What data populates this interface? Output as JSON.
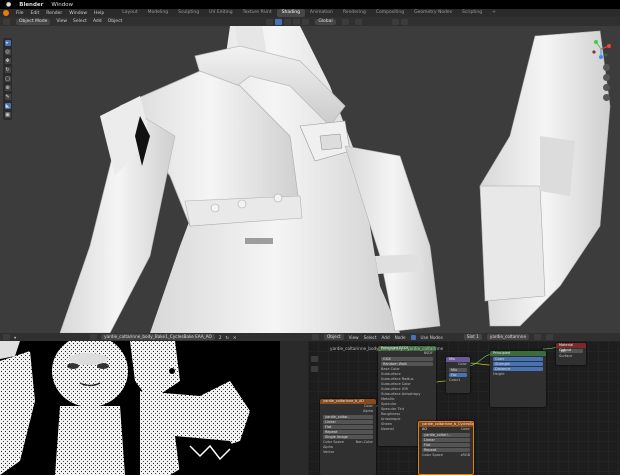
{
  "os_bar": {
    "app": "Blender",
    "menu": "Window"
  },
  "menu": {
    "items": [
      "File",
      "Edit",
      "Render",
      "Window",
      "Help"
    ]
  },
  "workspaces": {
    "tabs": [
      "Layout",
      "Modeling",
      "Sculpting",
      "UV Editing",
      "Texture Paint",
      "Shading",
      "Animation",
      "Rendering",
      "Compositing",
      "Geometry Nodes",
      "Scripting"
    ],
    "active": "Shading",
    "add": "+"
  },
  "viewport_header": {
    "mode": "Object Mode",
    "menus": [
      "View",
      "Select",
      "Add",
      "Object"
    ],
    "orientation": "Global"
  },
  "toolbar": {
    "tools": [
      "select",
      "cursor",
      "move",
      "rotate",
      "scale",
      "transform",
      "annotate",
      "measure",
      "add-cube"
    ]
  },
  "image_editor": {
    "image_name": "yardie_coltarinne_body_Bake1_CyclesBake EAA_AO",
    "datablock_buttons": [
      "2",
      "↻",
      "✕"
    ]
  },
  "node_editor": {
    "object_mode": "Object",
    "menus": [
      "View",
      "Select",
      "Add",
      "Node"
    ],
    "use_nodes_label": "Use Nodes",
    "slot": "Slot 1",
    "material": "yardie_coltarinne",
    "breadcrumb": "yardie_coltarinne_body_temporary   ›   yardie_coltarinne"
  },
  "nodes": {
    "bsdf": {
      "title": "Principled BSDF",
      "rows": [
        "GGX",
        "Random Walk",
        "Base Color",
        "Subsurface",
        "Subsurface Radius",
        "Subsurface Color",
        "Subsurface IOR",
        "Subsurface Anisotropy",
        "Metallic",
        "Specular",
        "Specular Tint",
        "Roughness",
        "Anisotropic",
        "Sheen",
        "Normal"
      ],
      "outputs": [
        "BSDF"
      ]
    },
    "mix": {
      "title": "Mix",
      "rows": [
        "Mix",
        "Clamp",
        "Fac",
        "Color1",
        "Color2"
      ],
      "outputs": [
        "Color"
      ]
    },
    "output": {
      "title": "Material Output",
      "rows": [
        "All",
        "Surface",
        "Volume",
        "Displacement"
      ]
    },
    "image_tex": {
      "title": "yardie_coltarinne_b_AO",
      "rows": [
        "Color",
        "Alpha",
        "Linear",
        "Flat",
        "Repeat",
        "Single Image",
        "Color Space",
        "Non-Color",
        "Alpha",
        "Vector"
      ],
      "fields": [
        "yardie_coltar.."
      ]
    },
    "image_tex2": {
      "title": "yardie_coltarinne_b_CyclesBake AO",
      "rows": [
        "Color",
        "Alpha",
        "Linear",
        "Flat",
        "Repeat",
        "Single Image",
        "Color Space",
        "sRGB",
        "Alpha",
        "Straight"
      ],
      "fields": [
        "yardie_coltari..."
      ]
    },
    "small": {
      "title": "Principled",
      "rows": [
        "Color",
        "Strength",
        "Distance",
        "Height"
      ]
    }
  },
  "colors": {
    "accent": "#4772b3",
    "blender_orange": "#e87d0d",
    "node_header_image": "#8a4a1a",
    "node_header_shader": "#3c6b3c",
    "node_header_output": "#7a2a2a"
  }
}
